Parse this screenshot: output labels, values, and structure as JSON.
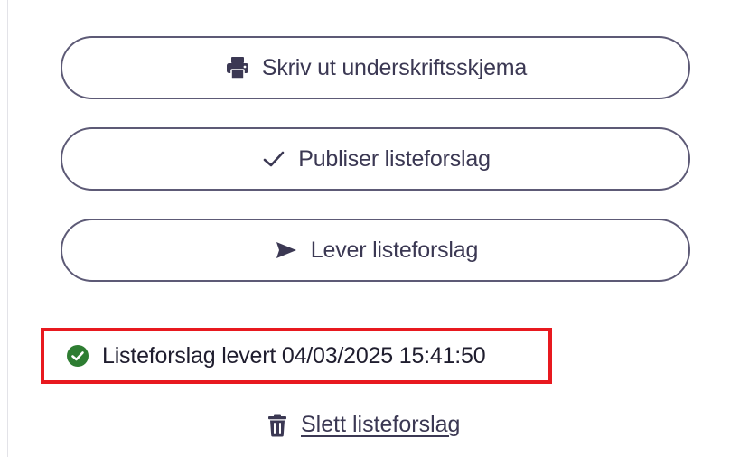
{
  "actions": {
    "print_label": "Skriv ut underskriftsskjema",
    "print_icon": "printer-icon",
    "publish_label": "Publiser listeforslag",
    "publish_icon": "checkmark-icon",
    "deliver_label": "Lever listeforslag",
    "deliver_icon": "send-icon"
  },
  "status": {
    "text": "Listeforslag levert 04/03/2025 15:41:50",
    "icon": "check-circle-icon",
    "icon_color": "#2e7d32",
    "highlight_color": "#e8191f"
  },
  "delete": {
    "label": "Slett listeforslag",
    "icon": "trash-icon"
  },
  "colors": {
    "button_border": "#5d5a76",
    "button_text": "#3b3853"
  }
}
